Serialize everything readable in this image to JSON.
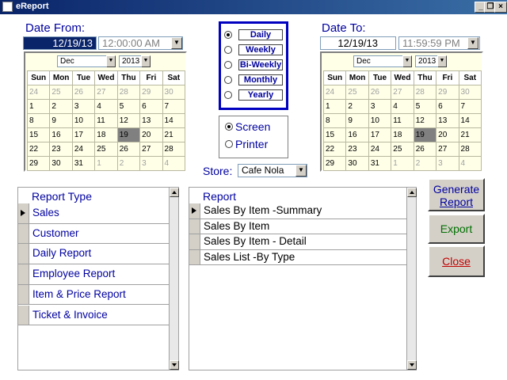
{
  "window": {
    "title": "eReport"
  },
  "date_from": {
    "label": "Date From:",
    "date": "12/19/13",
    "time": "12:00:00 AM",
    "calendar": {
      "month": "Dec",
      "year": "2013",
      "days_of_week": [
        "Sun",
        "Mon",
        "Tue",
        "Wed",
        "Thu",
        "Fri",
        "Sat"
      ],
      "weeks": [
        [
          "24",
          "25",
          "26",
          "27",
          "28",
          "29",
          "30"
        ],
        [
          "1",
          "2",
          "3",
          "4",
          "5",
          "6",
          "7"
        ],
        [
          "8",
          "9",
          "10",
          "11",
          "12",
          "13",
          "14"
        ],
        [
          "15",
          "16",
          "17",
          "18",
          "19",
          "20",
          "21"
        ],
        [
          "22",
          "23",
          "24",
          "25",
          "26",
          "27",
          "28"
        ],
        [
          "29",
          "30",
          "31",
          "1",
          "2",
          "3",
          "4"
        ]
      ]
    }
  },
  "date_to": {
    "label": "Date To:",
    "date": "12/19/13",
    "time": "11:59:59 PM",
    "calendar": {
      "month": "Dec",
      "year": "2013",
      "days_of_week": [
        "Sun",
        "Mon",
        "Tue",
        "Wed",
        "Thu",
        "Fri",
        "Sat"
      ],
      "weeks": [
        [
          "24",
          "25",
          "26",
          "27",
          "28",
          "29",
          "30"
        ],
        [
          "1",
          "2",
          "3",
          "4",
          "5",
          "6",
          "7"
        ],
        [
          "8",
          "9",
          "10",
          "11",
          "12",
          "13",
          "14"
        ],
        [
          "15",
          "16",
          "17",
          "18",
          "19",
          "20",
          "21"
        ],
        [
          "22",
          "23",
          "24",
          "25",
          "26",
          "27",
          "28"
        ],
        [
          "29",
          "30",
          "31",
          "1",
          "2",
          "3",
          "4"
        ]
      ]
    }
  },
  "frequency": {
    "options": [
      "Daily",
      "Weekly",
      "Bi-Weekly",
      "Monthly",
      "Yearly"
    ],
    "selected": "Daily"
  },
  "output": {
    "options": [
      "Screen",
      "Printer"
    ],
    "selected": "Screen"
  },
  "store": {
    "label": "Store:",
    "value": "Cafe Nola"
  },
  "report_type": {
    "header": "Report Type",
    "items": [
      "Sales",
      "Customer",
      "Daily Report",
      "Employee Report",
      "Item & Price Report",
      "Ticket & Invoice"
    ],
    "selected": "Sales"
  },
  "report": {
    "header": "Report",
    "items": [
      "Sales By Item -Summary",
      "Sales By Item",
      "Sales By Item - Detail",
      "Sales List -By Type"
    ],
    "selected": "Sales By Item -Summary"
  },
  "buttons": {
    "generate_line1": "Generate",
    "generate_line2": "Report",
    "export": "Export",
    "close": "Close"
  },
  "colors": {
    "label_blue": "#0000a0",
    "export_green": "#007000",
    "close_red": "#c00000",
    "title_bar": "#0a246a"
  }
}
